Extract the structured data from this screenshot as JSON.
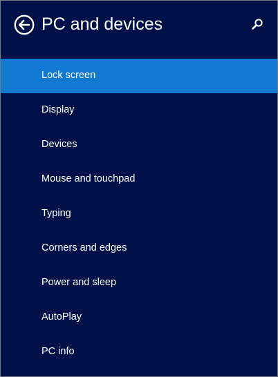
{
  "header": {
    "title": "PC and devices",
    "back_icon": "back-arrow-circle-icon",
    "search_icon": "search-icon"
  },
  "colors": {
    "background": "#00114a",
    "selected": "#1279d3",
    "text": "#ffffff"
  },
  "nav": {
    "selected_index": 0,
    "items": [
      {
        "label": "Lock screen"
      },
      {
        "label": "Display"
      },
      {
        "label": "Devices"
      },
      {
        "label": "Mouse and touchpad"
      },
      {
        "label": "Typing"
      },
      {
        "label": "Corners and edges"
      },
      {
        "label": "Power and sleep"
      },
      {
        "label": "AutoPlay"
      },
      {
        "label": "PC info"
      }
    ]
  }
}
